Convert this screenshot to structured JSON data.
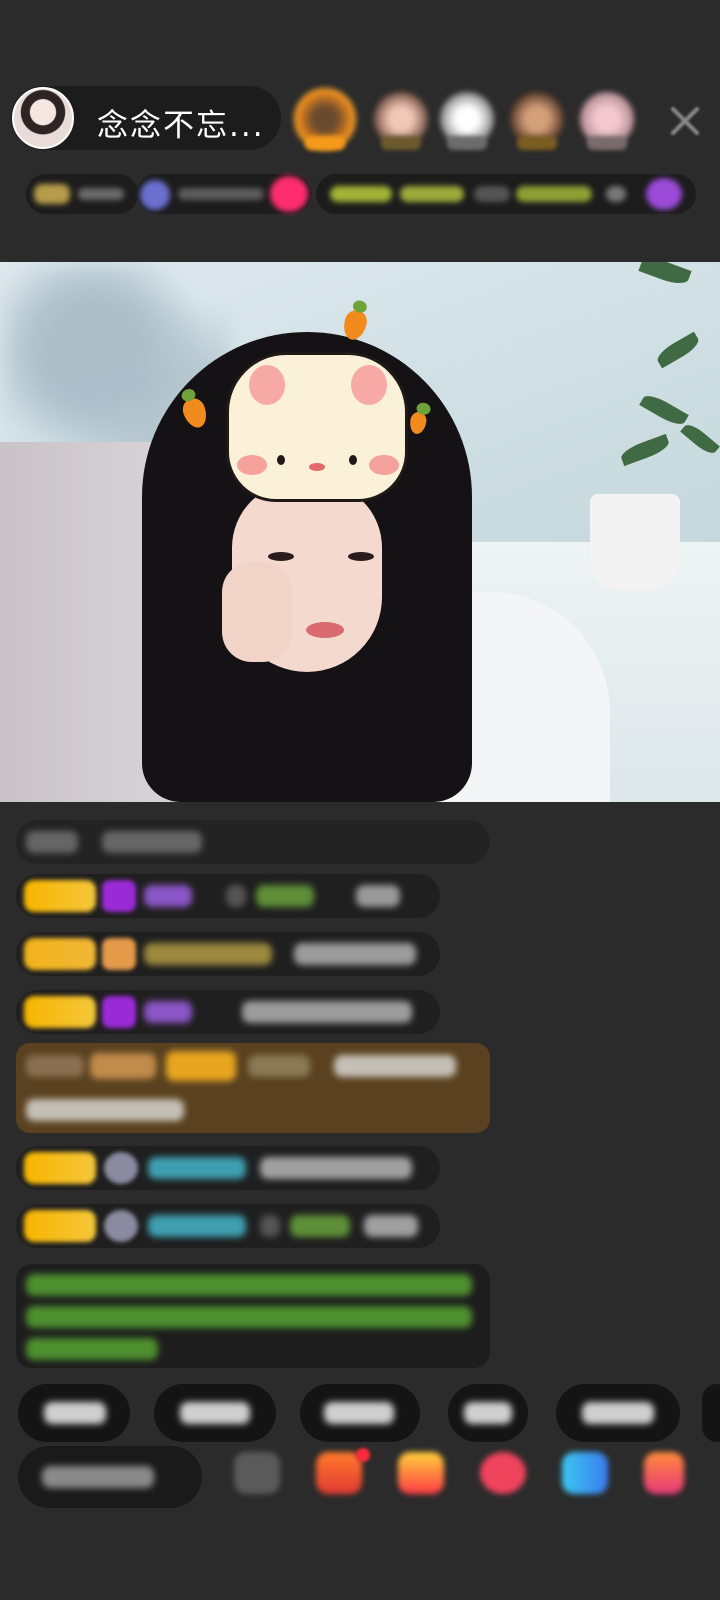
{
  "host": {
    "name": "念念不忘..."
  },
  "icons": {
    "close": "close-icon",
    "viewer_avatars": [
      "viewer-avatar-1",
      "viewer-avatar-2",
      "viewer-avatar-3",
      "viewer-avatar-4",
      "viewer-avatar-5"
    ],
    "gift": "gift-icon",
    "toolbar": [
      "emoji-icon",
      "gift-box-icon",
      "fries-icon",
      "lips-icon",
      "chat-bubble-icon",
      "grid-icon"
    ]
  },
  "colors": {
    "background": "#2b2b2b",
    "badge_yellow": "#f7b500",
    "highlight_brown": "#5a4220",
    "accent_pink": "#ff2d6f",
    "notification_red": "#ff2a3b"
  }
}
